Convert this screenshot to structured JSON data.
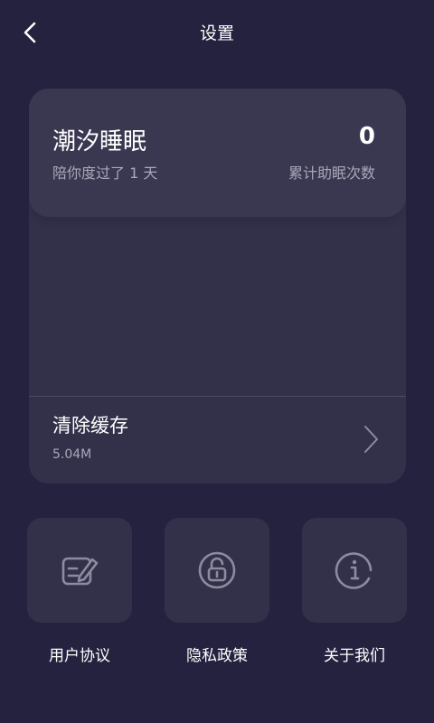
{
  "header": {
    "title": "设置"
  },
  "summary": {
    "app_name": "潮汐睡眠",
    "days_text": "陪你度过了 1 天",
    "count": "0",
    "count_label": "累计助眠次数"
  },
  "cache": {
    "label": "清除缓存",
    "size": "5.04M"
  },
  "tiles": [
    {
      "label": "用户协议",
      "icon": "edit-document-icon"
    },
    {
      "label": "隐私政策",
      "icon": "lock-icon"
    },
    {
      "label": "关于我们",
      "icon": "info-icon"
    }
  ],
  "colors": {
    "background": "#252240",
    "card": "#33314a",
    "card_top": "#3a3851",
    "icon": "#8d8ba0",
    "secondary_text": "#a9a7b8"
  }
}
